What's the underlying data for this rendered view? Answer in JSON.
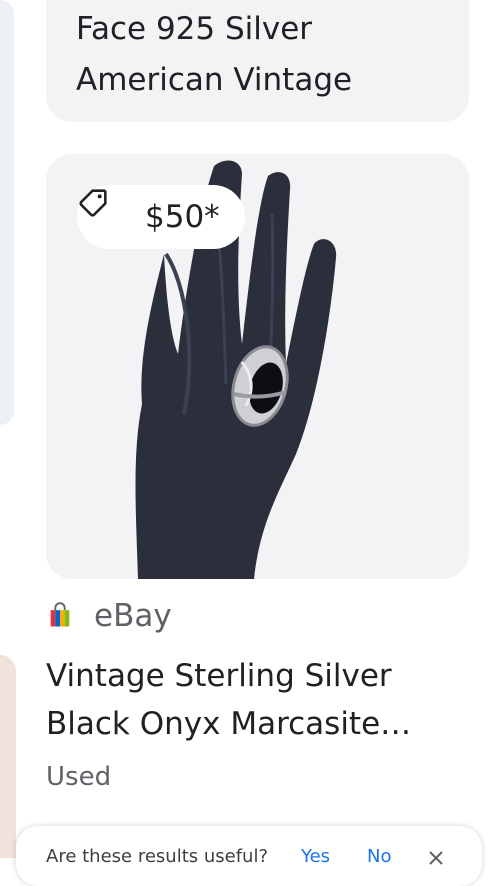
{
  "top_card": {
    "title": "Face 925 Silver American Vintage"
  },
  "product": {
    "price": "$50*",
    "source": "eBay",
    "title": "Vintage Sterling Silver Black Onyx Marcasite…",
    "condition": "Used"
  },
  "feedback": {
    "question": "Are these results useful?",
    "yes_label": "Yes",
    "no_label": "No"
  },
  "icons": {
    "price_tag": "tag-icon",
    "source": "ebay-shopping-bag-icon",
    "close": "close-icon"
  },
  "colors": {
    "text_primary": "#202124",
    "text_secondary": "#5f6368",
    "link_blue": "#1a73e8",
    "card_bg": "#f1f3f4"
  }
}
